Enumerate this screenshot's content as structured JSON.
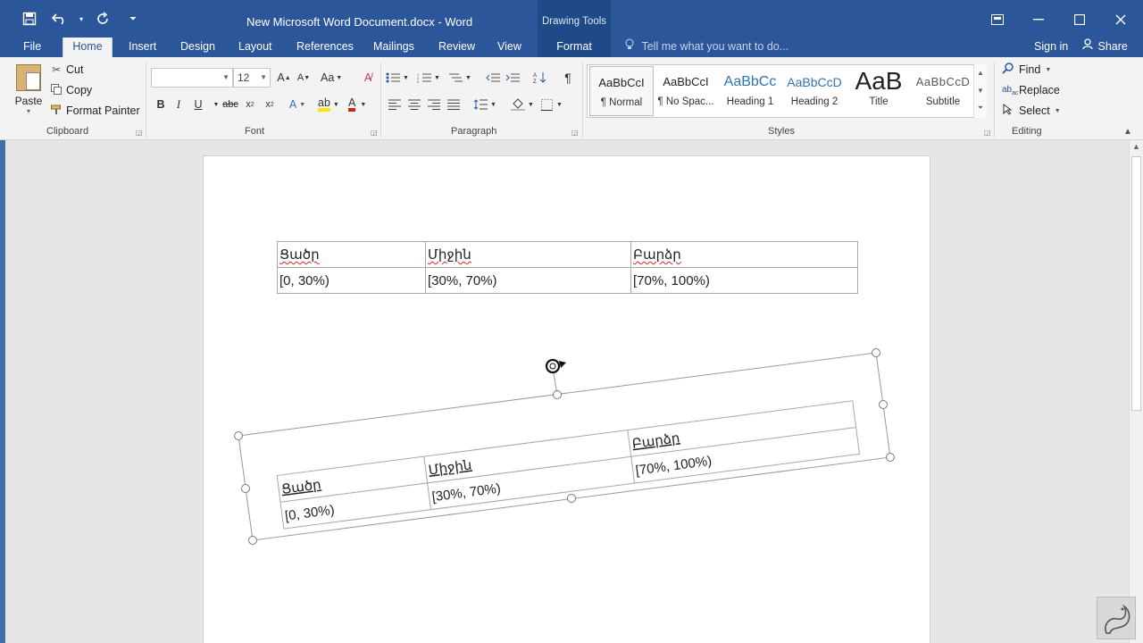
{
  "window": {
    "title": "New Microsoft Word Document.docx - Word",
    "contextual_group": "Drawing Tools",
    "qat": {
      "save_icon": "save-icon",
      "undo_icon": "undo-icon",
      "redo_icon": "redo-icon",
      "customize_icon": "customize-qat-icon"
    },
    "controls": [
      "ribbon-display-icon",
      "minimize-icon",
      "maximize-icon",
      "close-icon"
    ]
  },
  "tabs": [
    {
      "label": "File"
    },
    {
      "label": "Home"
    },
    {
      "label": "Insert"
    },
    {
      "label": "Design"
    },
    {
      "label": "Layout"
    },
    {
      "label": "References"
    },
    {
      "label": "Mailings"
    },
    {
      "label": "Review"
    },
    {
      "label": "View"
    },
    {
      "label": "Format"
    }
  ],
  "active_tab": "Home",
  "tell_me": "Tell me what you want to do...",
  "sign_in": "Sign in",
  "share": "Share",
  "clipboard": {
    "paste": "Paste",
    "cut": "Cut",
    "copy": "Copy",
    "format_painter": "Format Painter",
    "label": "Clipboard"
  },
  "font": {
    "name": "",
    "size": "12",
    "label": "Font"
  },
  "paragraph": {
    "label": "Paragraph"
  },
  "styles": {
    "label": "Styles",
    "items": [
      {
        "preview": "AaBbCcI",
        "name": "¶ Normal"
      },
      {
        "preview": "AaBbCcI",
        "name": "¶ No Spac..."
      },
      {
        "preview": "AaBbCc",
        "name": "Heading 1"
      },
      {
        "preview": "AaBbCcD",
        "name": "Heading 2"
      },
      {
        "preview": "AaB",
        "name": "Title"
      },
      {
        "preview": "AaBbCcD",
        "name": "Subtitle"
      }
    ]
  },
  "editing": {
    "find": "Find",
    "replace": "Replace",
    "select": "Select",
    "label": "Editing"
  },
  "document": {
    "table": {
      "headers": [
        "Ցածր",
        "Միջին",
        "Բարձր"
      ],
      "row": [
        "[0, 30%)",
        "[30%, 70%)",
        "[70%, 100%)"
      ]
    }
  }
}
